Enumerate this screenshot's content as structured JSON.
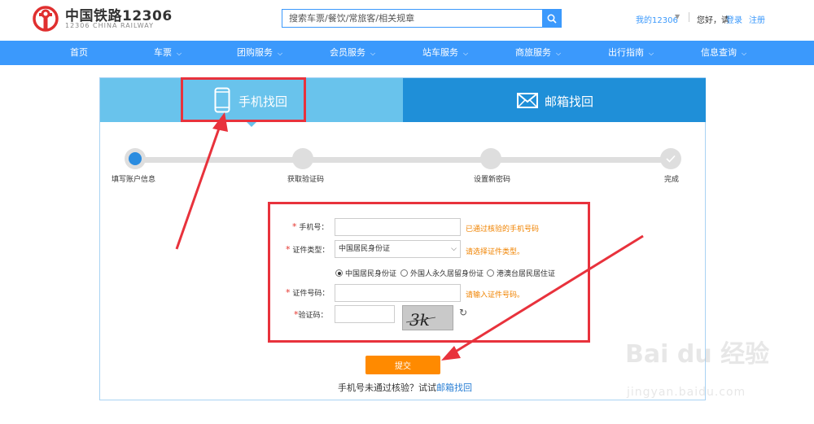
{
  "header": {
    "logo_cn": "中国铁路12306",
    "logo_en": "12306 CHINA RAILWAY",
    "search_placeholder": "搜索车票/餐饮/常旅客/相关规章",
    "my_12306": "我的12306",
    "greeting": "您好，请",
    "login": "登录",
    "register": "注册"
  },
  "nav": {
    "items": [
      {
        "label": "首页"
      },
      {
        "label": "车票"
      },
      {
        "label": "团购服务"
      },
      {
        "label": "会员服务"
      },
      {
        "label": "站车服务"
      },
      {
        "label": "商旅服务"
      },
      {
        "label": "出行指南"
      },
      {
        "label": "信息查询"
      }
    ]
  },
  "tabs": {
    "phone": "手机找回",
    "email": "邮箱找回"
  },
  "steps": {
    "items": [
      {
        "label": "填写账户信息"
      },
      {
        "label": "获取验证码"
      },
      {
        "label": "设置新密码"
      },
      {
        "label": "完成"
      }
    ]
  },
  "form": {
    "phone_label": "手机号：",
    "phone_hint": "已通过核验的手机号码",
    "id_type_label": "证件类型：",
    "id_type_value": "中国居民身份证",
    "id_type_hint": "请选择证件类型。",
    "radio_options": [
      "中国居民身份证",
      "外国人永久居留身份证",
      "港澳台居民居住证"
    ],
    "id_number_label": "证件号码：",
    "id_number_hint": "请输入证件号码。",
    "captcha_label": "验证码：",
    "captcha_text": "3k",
    "required_mark": "*",
    "submit": "提交",
    "email_prompt": "手机号未通过核验？试试",
    "email_link": "邮箱找回"
  },
  "watermark": {
    "logo": "Bai du 经验",
    "url": "jingyan.baidu.com"
  },
  "colors": {
    "brand_blue": "#3b99fc",
    "tab_active": "#69c3ec",
    "tab_inactive": "#1f8fd8",
    "submit": "#ff8a00",
    "hint": "#f08300",
    "annotation_red": "#e8323c"
  }
}
